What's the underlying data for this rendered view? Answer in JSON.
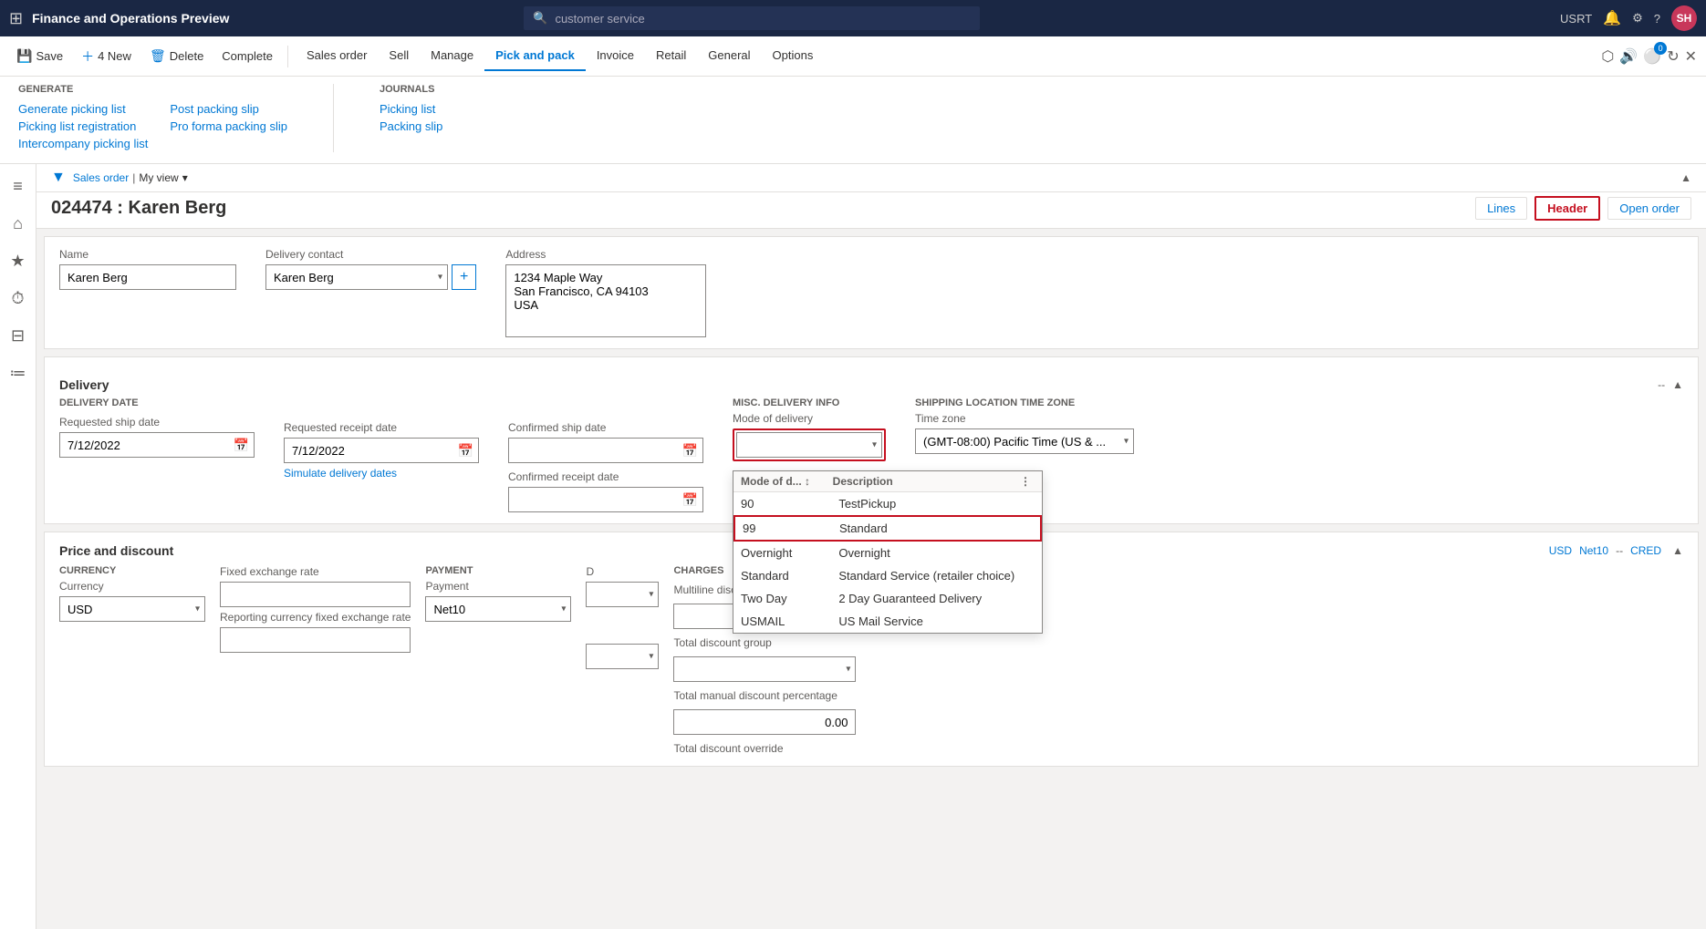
{
  "app": {
    "title": "Finance and Operations Preview",
    "search_placeholder": "customer service",
    "user": "USRT",
    "avatar": "SH",
    "avatar_bg": "#c8375a"
  },
  "toolbar": {
    "save": "Save",
    "new": "New",
    "delete": "Delete",
    "complete": "Complete",
    "new_count": "4 New",
    "complete_label": "Complete"
  },
  "menu_tabs": [
    {
      "label": "Sales order",
      "active": false
    },
    {
      "label": "Sell",
      "active": false
    },
    {
      "label": "Manage",
      "active": false
    },
    {
      "label": "Pick and pack",
      "active": true
    },
    {
      "label": "Invoice",
      "active": false
    },
    {
      "label": "Retail",
      "active": false
    },
    {
      "label": "General",
      "active": false
    },
    {
      "label": "Options",
      "active": false
    }
  ],
  "dropdown_menu": {
    "generate_title": "Generate",
    "generate_items": [
      "Generate picking list",
      "Picking list registration",
      "Intercompany picking list"
    ],
    "post_items": [
      "Post packing slip",
      "Pro forma packing slip"
    ],
    "journals_title": "Journals",
    "journals_items": [
      "Picking list",
      "Packing slip"
    ]
  },
  "breadcrumb": {
    "order_link": "Sales order",
    "separator": "|",
    "view": "My view"
  },
  "page": {
    "order_id": "024474",
    "customer_name": "Karen Berg",
    "title": "024474 : Karen Berg"
  },
  "page_nav": {
    "lines": "Lines",
    "header": "Header",
    "open_order": "Open order"
  },
  "form": {
    "name_label": "Name",
    "name_value": "Karen Berg",
    "delivery_contact_label": "Delivery contact",
    "delivery_contact_value": "Karen Berg",
    "address_label": "Address",
    "address_line1": "1234 Maple Way",
    "address_line2": "San Francisco, CA 94103",
    "address_line3": "USA"
  },
  "delivery": {
    "section_title": "Delivery",
    "delivery_date_label": "DELIVERY DATE",
    "requested_ship_date_label": "Requested ship date",
    "requested_ship_date": "7/12/2022",
    "requested_receipt_date_label": "Requested receipt date",
    "requested_receipt_date": "7/12/2022",
    "simulate_link": "Simulate delivery dates",
    "confirmed_ship_date_label": "Confirmed ship date",
    "confirmed_ship_date": "",
    "confirmed_receipt_date_label": "Confirmed receipt date",
    "confirmed_receipt_date": "",
    "misc_info_label": "MISC. DELIVERY INFO",
    "mode_of_delivery_label": "Mode of delivery",
    "mode_of_delivery_value": "",
    "shipping_tz_label": "SHIPPING LOCATION TIME ZONE",
    "time_zone_label": "Time zone",
    "time_zone_value": "(GMT-08:00) Pacific Time (US & ..."
  },
  "mode_of_delivery_dropdown": {
    "col1_header": "Mode of d...",
    "col2_header": "Description",
    "items": [
      {
        "code": "90",
        "desc": "TestPickup",
        "highlighted": false
      },
      {
        "code": "99",
        "desc": "Standard",
        "highlighted": true
      },
      {
        "code": "Overnight",
        "desc": "Overnight",
        "highlighted": false
      },
      {
        "code": "Standard",
        "desc": "Standard Service (retailer choice)",
        "highlighted": false
      },
      {
        "code": "Two Day",
        "desc": "2 Day Guaranteed Delivery",
        "highlighted": false
      },
      {
        "code": "USMAIL",
        "desc": "US Mail Service",
        "highlighted": false
      }
    ]
  },
  "price": {
    "section_title": "Price and discount",
    "currency_label": "CURRENCY",
    "currency_sublabel": "Currency",
    "currency_value": "USD",
    "fixed_rate_label": "Fixed exchange rate",
    "fixed_rate_value": "",
    "reporting_rate_label": "Reporting currency fixed exchange rate",
    "reporting_rate_value": "",
    "payment_label": "PAYMENT",
    "payment_sublabel": "Payment",
    "payment_value": "Net10",
    "charges_label": "CHARGES",
    "multiline_disc_label": "Multiline disc. group",
    "multiline_disc_value": "",
    "total_disc_label": "Total discount group",
    "total_disc_value": "",
    "total_manual_disc_label": "Total manual discount percentage",
    "total_manual_disc_value": "0.00",
    "total_disc_override_label": "Total discount override",
    "tags": [
      "USD",
      "Net10",
      "--",
      "CRED"
    ]
  },
  "section_top_right": {
    "collapse_icon": "▲"
  },
  "sidebar_icons": [
    "≡",
    "⌂",
    "★",
    "⏱",
    "⊟",
    "≔"
  ]
}
